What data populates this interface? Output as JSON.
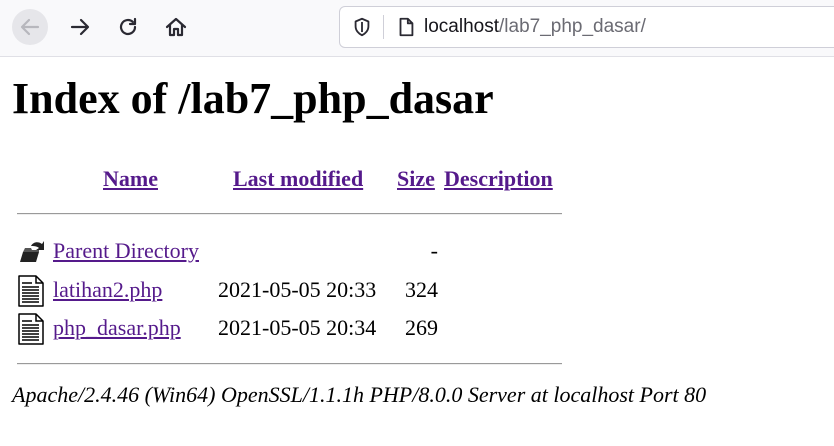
{
  "browser": {
    "url_host": "localhost",
    "url_path": "/lab7_php_dasar/",
    "icons": {
      "back": "arrow-left-icon",
      "forward": "arrow-right-icon",
      "reload": "reload-icon",
      "home": "home-icon",
      "site_info": "shield-icon",
      "page": "page-icon"
    }
  },
  "page": {
    "title": "Index of /lab7_php_dasar",
    "columns": {
      "name": "Name",
      "last_modified": "Last modified",
      "size": "Size",
      "description": "Description"
    },
    "rows": [
      {
        "icon": "back-folder-icon",
        "name": "Parent Directory",
        "modified": "",
        "size": "-"
      },
      {
        "icon": "text-file-icon",
        "name": "latihan2.php",
        "modified": "2021-05-05 20:33",
        "size": "324"
      },
      {
        "icon": "text-file-icon",
        "name": "php_dasar.php",
        "modified": "2021-05-05 20:34",
        "size": "269"
      }
    ],
    "footer": "Apache/2.4.46 (Win64) OpenSSL/1.1.1h PHP/8.0.0 Server at localhost Port 80"
  },
  "colors": {
    "link_visited": "#551a8b",
    "link_unvisited": "#0000ee",
    "toolbar_bg": "#f9f9fb"
  }
}
